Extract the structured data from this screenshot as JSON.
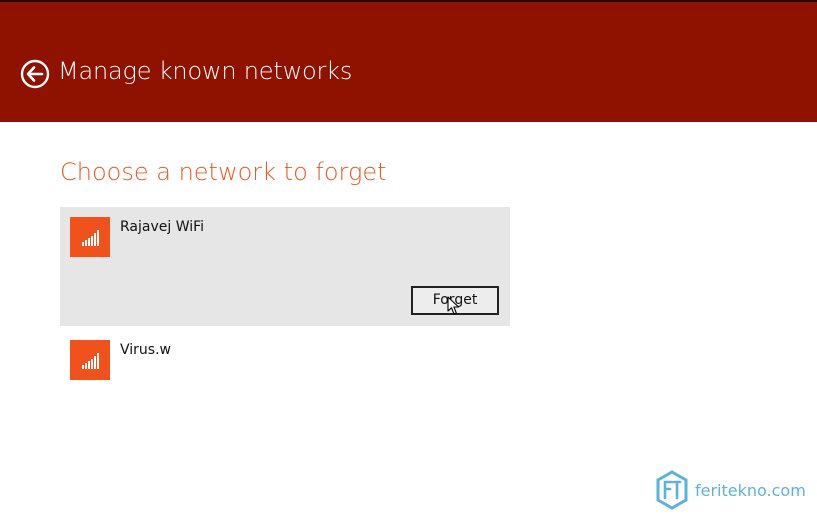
{
  "header": {
    "title": "Manage known networks",
    "back_icon": "back-arrow-circle-icon",
    "background_color": "#8f1200"
  },
  "main": {
    "section_title": "Choose a network to forget",
    "accent_color": "#e55a1f",
    "networks": [
      {
        "name": "Rajavej WiFi",
        "icon": "wifi-signal-icon",
        "selected": true,
        "forget_label": "Forget"
      },
      {
        "name": "Virus.w",
        "icon": "wifi-signal-icon",
        "selected": false
      }
    ],
    "tile_color": "#f1521b"
  },
  "watermark": {
    "text": "feritekno.com",
    "logo_icon": "feritekno-hexagon-logo",
    "color": "#5bb3dc"
  }
}
